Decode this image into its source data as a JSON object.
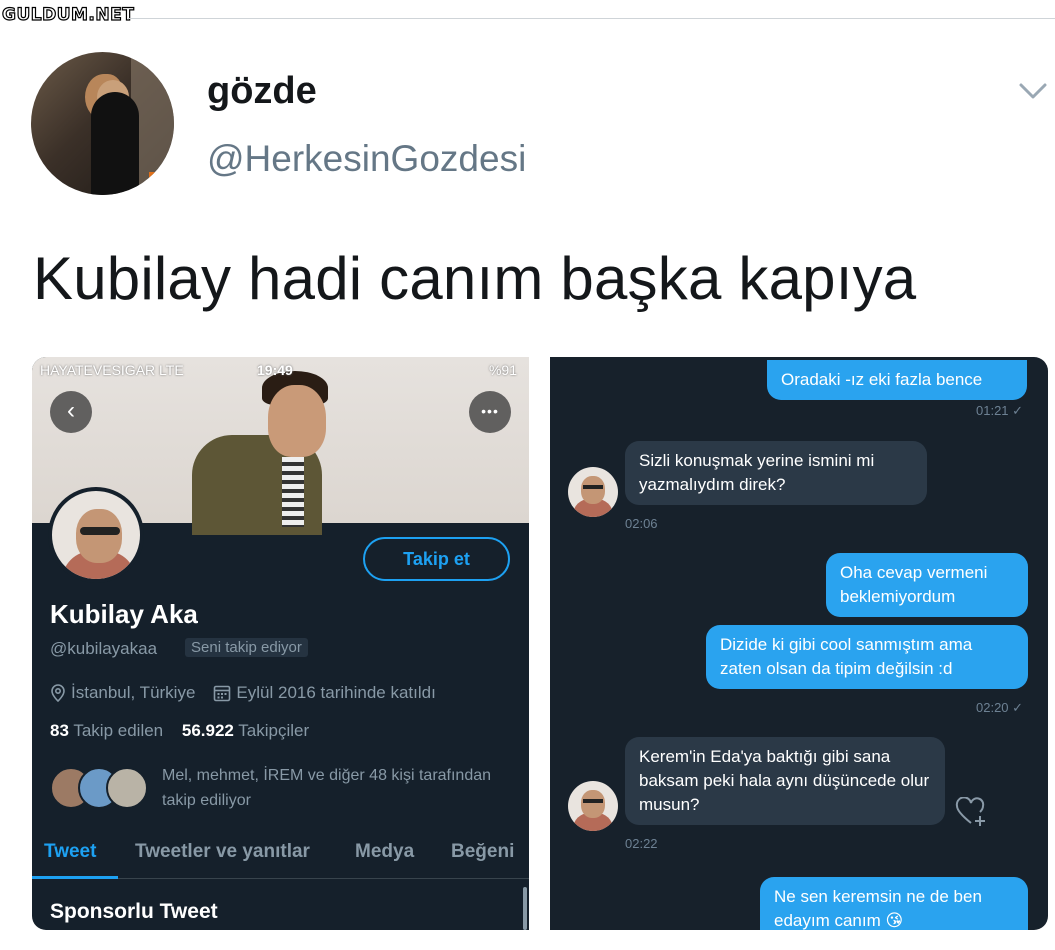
{
  "watermark": "GULDUM.NET",
  "tweet": {
    "display_name": "gözde",
    "handle": "@HerkesinGozdesi",
    "text": "Kubilay hadi canım başka kapıya",
    "menu_icon": "chevron-down-icon"
  },
  "left_screenshot": {
    "status_bar": {
      "carrier": "HAYATEVESIGAR  LTE",
      "time": "19:49",
      "battery": "%91"
    },
    "back_icon": "chevron-left-icon",
    "more_icon": "more-dots-icon",
    "follow_button": "Takip et",
    "name": "Kubilay Aka",
    "handle": "@kubilayakaa",
    "follows_you": "Seni takip ediyor",
    "location": "İstanbul, Türkiye",
    "joined": "Eylül 2016 tarihinde katıldı",
    "following_count": "83",
    "following_label": "Takip edilen",
    "followers_count": "56.922",
    "followers_label": "Takipçiler",
    "followed_by": "Mel, mehmet, İREM ve diğer 48 kişi tarafından takip ediliyor",
    "tabs": [
      "Tweet",
      "Tweetler ve yanıtlar",
      "Medya",
      "Beğeni"
    ],
    "active_tab": "Tweet",
    "sponsored": "Sponsorlu Tweet",
    "colors": {
      "background": "#15202b",
      "accent": "#1da1f2"
    }
  },
  "right_screenshot": {
    "messages": [
      {
        "dir": "out",
        "text": "Oradaki -ız eki fazla bence",
        "time": "01:21 ✓"
      },
      {
        "dir": "in",
        "text": "Sizli konuşmak yerine ismini mi yazmalıydım direk?",
        "time": "02:06"
      },
      {
        "dir": "out",
        "text": "Oha cevap vermeni beklemiyordum",
        "time": ""
      },
      {
        "dir": "out",
        "text": "Dizide ki gibi cool sanmıştım ama zaten olsan da tipim değilsin :d",
        "time": "02:20 ✓"
      },
      {
        "dir": "in",
        "text": "Kerem'in Eda'ya baktığı gibi sana baksam peki hala aynı düşüncede olur musun?",
        "time": "02:22"
      },
      {
        "dir": "out",
        "text": "Ne sen keremsin ne de ben edayım canım 😘",
        "time": ""
      }
    ],
    "react_icon": "heart-plus-icon",
    "colors": {
      "background": "#17212b",
      "outgoing": "#2aa3ef",
      "incoming": "#2b3947"
    }
  }
}
